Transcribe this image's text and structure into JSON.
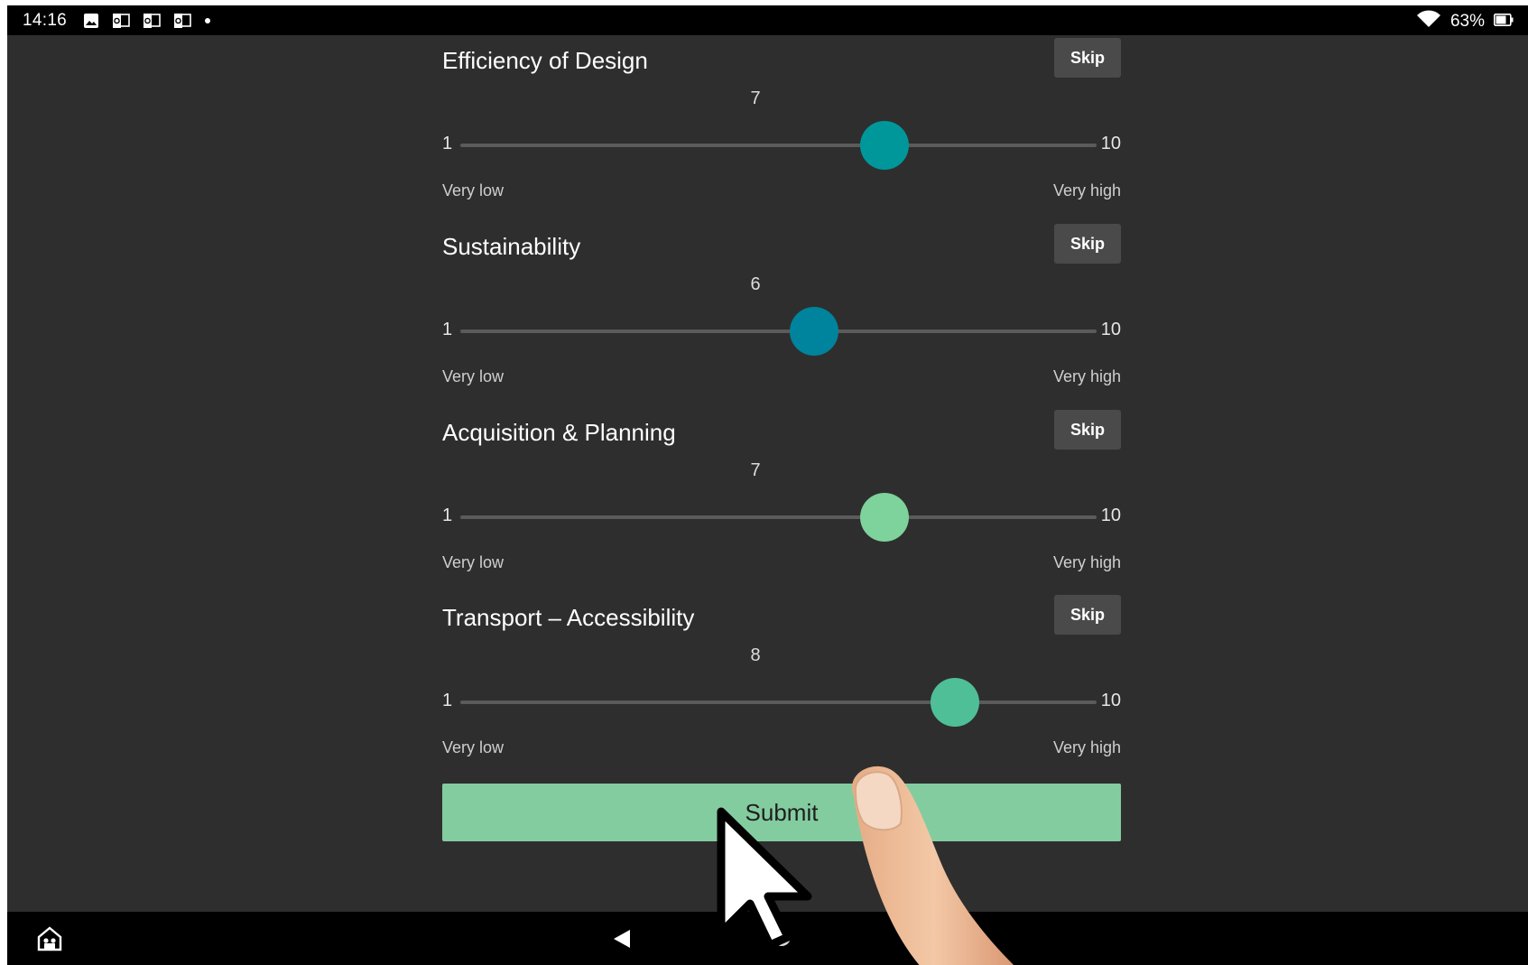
{
  "status_bar": {
    "time": "14:16",
    "battery": "63%",
    "notification_icons": [
      "image-icon",
      "outlook-icon",
      "outlook-icon",
      "outlook-icon",
      "dot-icon"
    ]
  },
  "questions": [
    {
      "title": "Efficiency of Design",
      "skip": "Skip",
      "value": "7",
      "value_num": 7,
      "min": "1",
      "max": "10",
      "low_label": "Very low",
      "high_label": "Very high",
      "color": "#00979a"
    },
    {
      "title": "Sustainability",
      "skip": "Skip",
      "value": "6",
      "value_num": 6,
      "min": "1",
      "max": "10",
      "low_label": "Very low",
      "high_label": "Very high",
      "color": "#00839c"
    },
    {
      "title": "Acquisition & Planning",
      "skip": "Skip",
      "value": "7",
      "value_num": 7,
      "min": "1",
      "max": "10",
      "low_label": "Very low",
      "high_label": "Very high",
      "color": "#7ed29b"
    },
    {
      "title": "Transport – Accessibility",
      "skip": "Skip",
      "value": "8",
      "value_num": 8,
      "min": "1",
      "max": "10",
      "low_label": "Very low",
      "high_label": "Very high",
      "color": "#4fbf97"
    }
  ],
  "submit_label": "Submit",
  "colors": {
    "background": "#2e2e2e",
    "submit": "#83cc9f",
    "skip_button": "#4a4a4a"
  }
}
